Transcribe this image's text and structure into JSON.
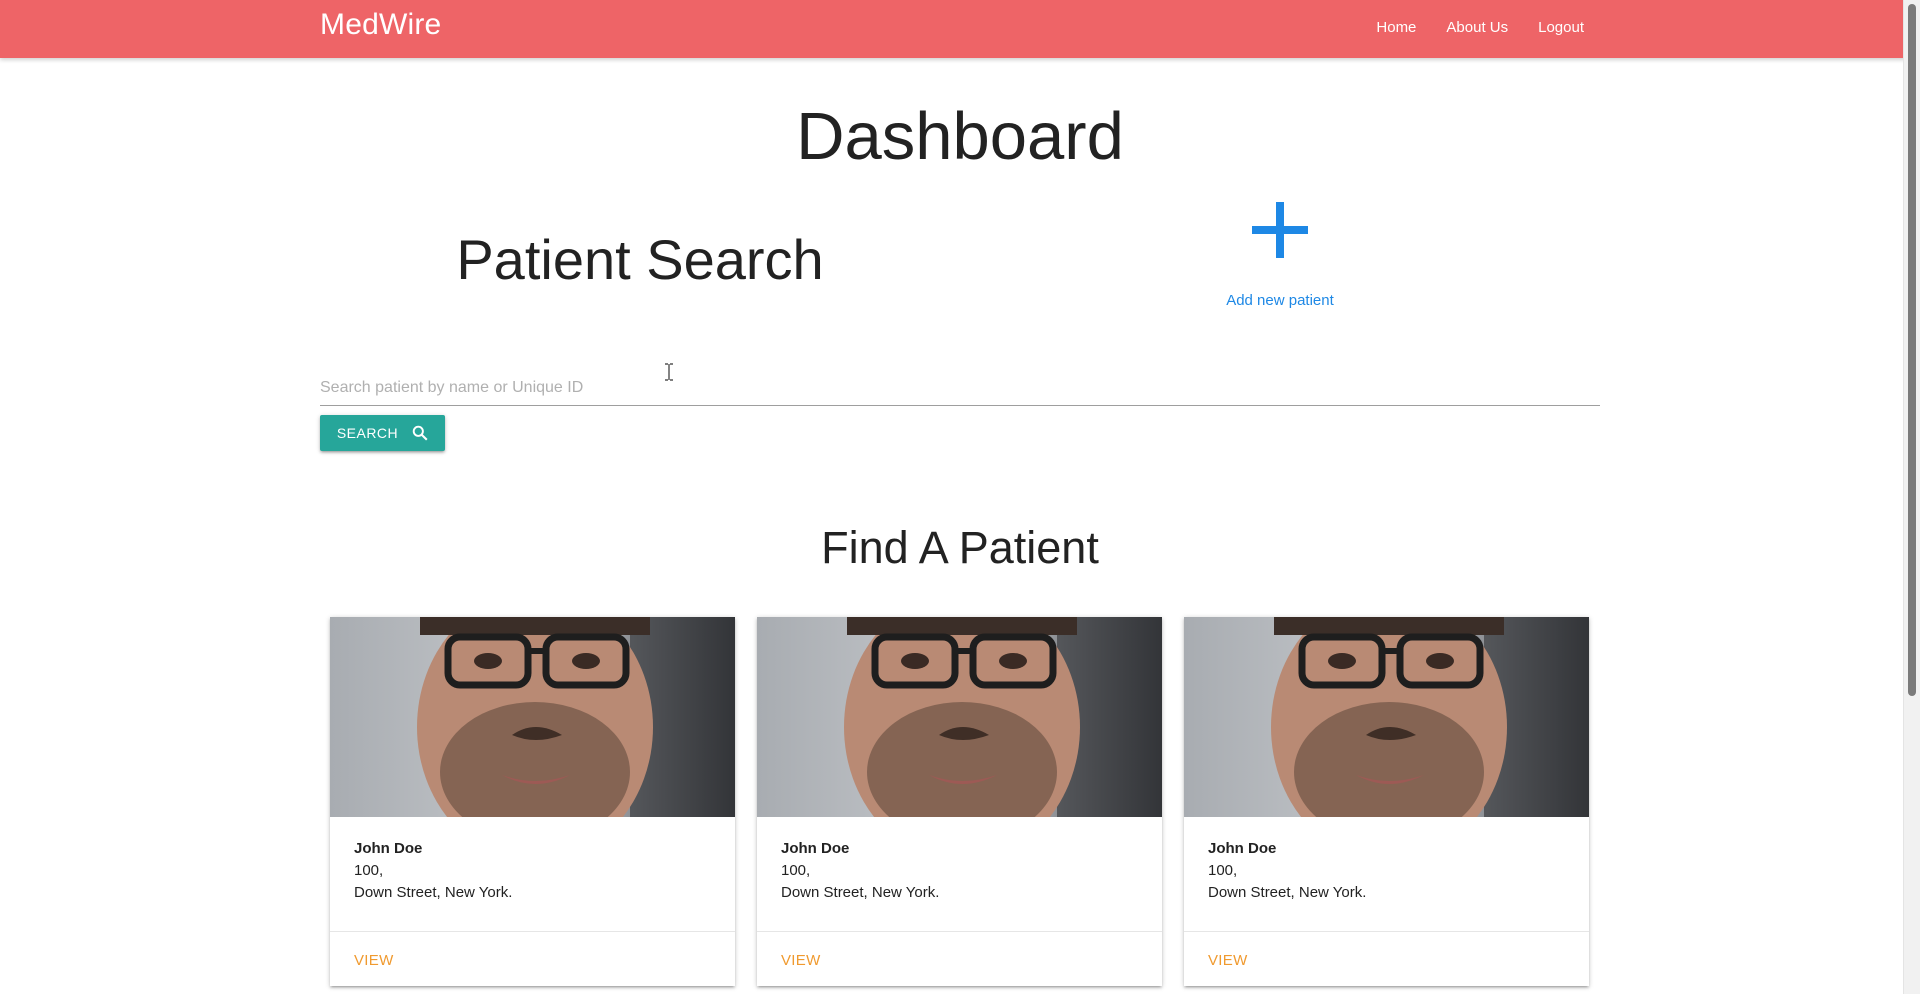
{
  "navbar": {
    "brand": "MedWire",
    "links": [
      {
        "label": "Home"
      },
      {
        "label": "About Us"
      },
      {
        "label": "Logout"
      }
    ],
    "background_color": "#ee6467"
  },
  "dashboard": {
    "title": "Dashboard"
  },
  "patient_search": {
    "title": "Patient Search",
    "placeholder": "Search patient by name or Unique ID",
    "value": "",
    "search_button_label": "SEARCH",
    "search_button_color": "#26a69a",
    "search_icon": "search-icon"
  },
  "add_patient": {
    "icon": "plus-icon",
    "label": "Add new patient",
    "color": "#1e88e5"
  },
  "find_patient": {
    "title": "Find A Patient",
    "cards": [
      {
        "name": "John Doe",
        "address_line1": "100,",
        "address_line2": "Down Street, New York.",
        "action": "VIEW"
      },
      {
        "name": "John Doe",
        "address_line1": "100,",
        "address_line2": "Down Street, New York.",
        "action": "VIEW"
      },
      {
        "name": "John Doe",
        "address_line1": "100,",
        "address_line2": "Down Street, New York.",
        "action": "VIEW"
      }
    ],
    "action_color": "#f09a2f"
  }
}
